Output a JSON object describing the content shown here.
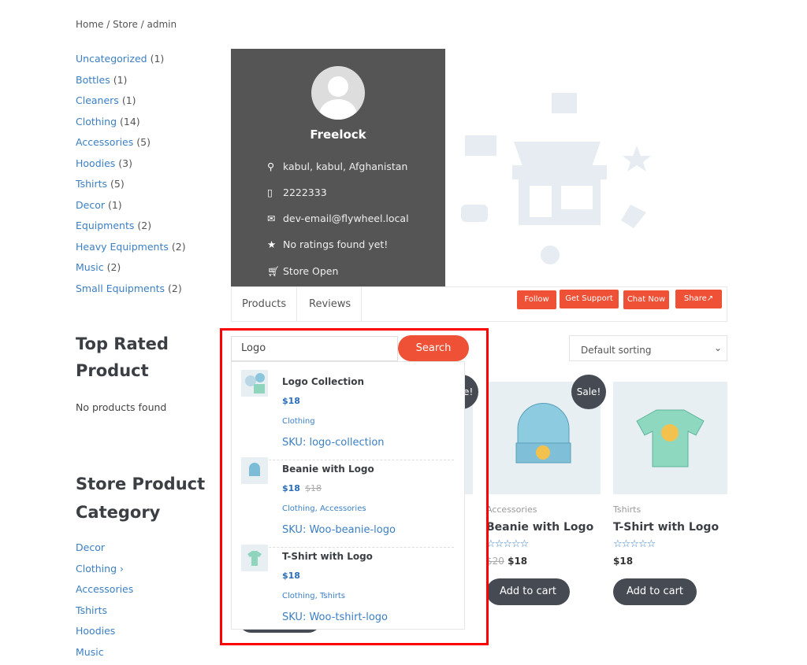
{
  "breadcrumb": "Home / Store / admin",
  "categories": [
    {
      "name": "Uncategorized",
      "count": "(1)"
    },
    {
      "name": "Bottles",
      "count": "(1)"
    },
    {
      "name": "Cleaners",
      "count": "(1)"
    },
    {
      "name": "Clothing",
      "count": "(14)"
    },
    {
      "name": "Accessories",
      "count": "(5)"
    },
    {
      "name": "Hoodies",
      "count": "(3)"
    },
    {
      "name": "Tshirts",
      "count": "(5)"
    },
    {
      "name": "Decor",
      "count": "(1)"
    },
    {
      "name": "Equipments",
      "count": "(2)"
    },
    {
      "name": "Heavy Equipments",
      "count": "(2)"
    },
    {
      "name": "Music",
      "count": "(2)"
    },
    {
      "name": "Small Equipments",
      "count": "(2)"
    }
  ],
  "top_rated": {
    "title_line1": "Top Rated",
    "title_line2": "Product",
    "empty": "No products found"
  },
  "store_category": {
    "title_line1": "Store Product",
    "title_line2": "Category",
    "items": [
      "Decor",
      "Clothing ›",
      "Accessories",
      "Tshirts",
      "Hoodies",
      "Music"
    ]
  },
  "store": {
    "name": "Freelock",
    "address": "kabul, kabul, Afghanistan",
    "phone": "2222333",
    "email": "dev-email@flywheel.local",
    "rating": "No ratings found yet!",
    "status": "Store Open"
  },
  "tabs": [
    "Products",
    "Reviews"
  ],
  "store_buttons": {
    "follow": "Follow",
    "support": "Get Support",
    "chat": "Chat Now",
    "share": "Share"
  },
  "search": {
    "value": "Logo",
    "button": "Search"
  },
  "sorting": "Default sorting",
  "results": [
    {
      "title": "Logo Collection",
      "price": "$18",
      "old_price": "",
      "cats": "Clothing",
      "sku": "SKU: logo-collection"
    },
    {
      "title": "Beanie with Logo",
      "price": "$18",
      "old_price": "$18",
      "cats": "Clothing, Accessories",
      "sku": "SKU: Woo-beanie-logo"
    },
    {
      "title": "T-Shirt with Logo",
      "price": "$18",
      "old_price": "",
      "cats": "Clothing, Tshirts",
      "sku": "SKU: Woo-tshirt-logo"
    }
  ],
  "products": [
    {
      "sale": "Sale!",
      "category": "Accessories",
      "title": "Beanie with Logo",
      "stars": "☆☆☆☆☆",
      "old_price": "$20",
      "price": "$18",
      "cart": "Add to cart"
    },
    {
      "sale": "",
      "category": "Tshirts",
      "title": "T-Shirt with Logo",
      "stars": "☆☆☆☆☆",
      "old_price": "",
      "price": "$18",
      "cart": "Add to cart"
    }
  ],
  "hidden_sale": "Sale!",
  "colors": {
    "accent": "#ee5135",
    "link": "#3a7fc4",
    "banner": "#555555",
    "highlight": "#ff0000"
  }
}
